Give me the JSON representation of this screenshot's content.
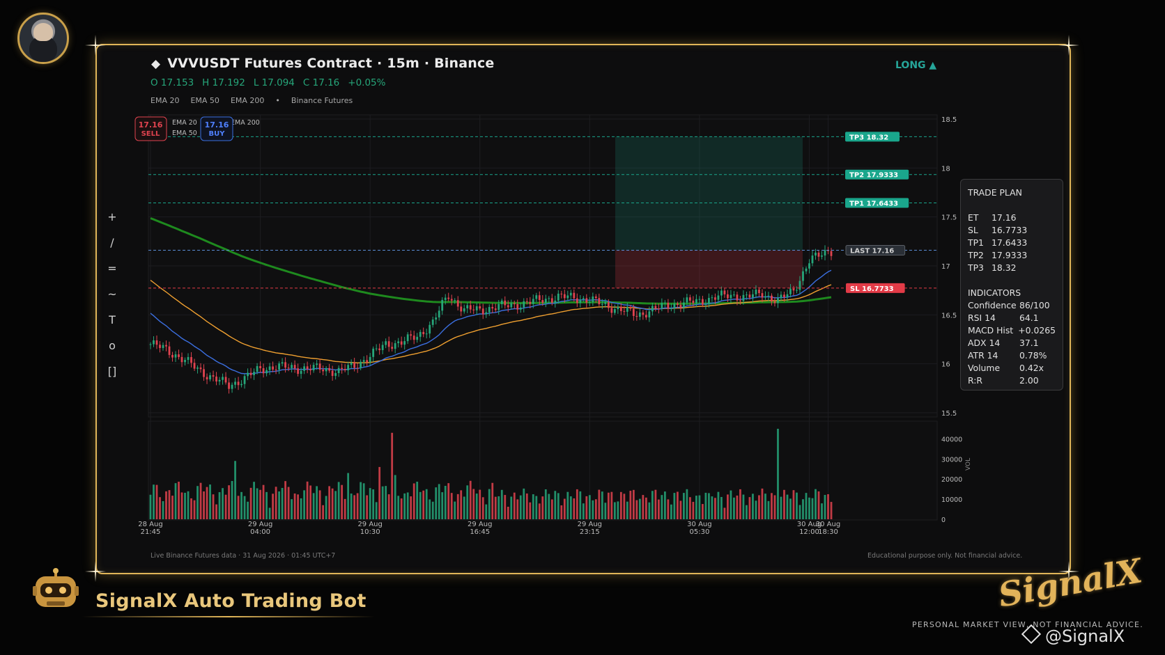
{
  "header": {
    "title": "VVVUSDT Futures Contract · 15m · Binance",
    "open": "O 17.153",
    "high": "H 17.192",
    "low": "L 17.094",
    "close": "C 17.16",
    "change": "+0.05%",
    "indicators": [
      "EMA 20",
      "EMA 50",
      "EMA 200",
      "•",
      "Binance Futures"
    ],
    "direction": "LONG ▲"
  },
  "toolbar": [
    "+",
    "/",
    "=",
    "~",
    "T",
    "o",
    "[]"
  ],
  "chart_badges": {
    "sell_price": "17.16",
    "sell_label": "SELL",
    "buy_price": "17.16",
    "buy_label": "BUY",
    "legend": [
      "EMA 20",
      "EMA 50",
      "EMA 200"
    ]
  },
  "trade_plan": {
    "heading": "TRADE PLAN",
    "levels": [
      {
        "k": "ET",
        "v": "17.16"
      },
      {
        "k": "SL",
        "v": "16.7733"
      },
      {
        "k": "TP1",
        "v": "17.6433"
      },
      {
        "k": "TP2",
        "v": "17.9333"
      },
      {
        "k": "TP3",
        "v": "18.32"
      }
    ],
    "indicators_heading": "INDICATORS",
    "indicators": [
      {
        "k": "Confidence",
        "v": "86/100"
      },
      {
        "k": "RSI 14",
        "v": "64.1"
      },
      {
        "k": "MACD Hist",
        "v": "+0.0265"
      },
      {
        "k": "ADX 14",
        "v": "37.1"
      },
      {
        "k": "ATR 14",
        "v": "0.78%"
      },
      {
        "k": "Volume",
        "v": "0.42x"
      },
      {
        "k": "R:R",
        "v": "2.00"
      }
    ]
  },
  "footer": {
    "left": "Live Binance Futures data  ·  31 Aug 2026 · 01:45 UTC+7",
    "right": "Educational purpose only. Not financial advice."
  },
  "branding": {
    "bot_name": "SignalX Auto Trading Bot",
    "logo_text": "SignalX",
    "disclaimer": "PERSONAL MARKET VIEW, NOT FINANCIAL ADVICE.",
    "handle": "@SignalX"
  },
  "colors": {
    "up": "#26a67a",
    "down": "#e0434f",
    "ema20": "#3b6fe0",
    "ema50": "#f0a030",
    "ema200": "#1e8a1e",
    "tp": "#1aa68c",
    "sl": "#e33b47",
    "gold": "#e1b659"
  },
  "chart_data": {
    "type": "candlestick",
    "symbol": "VVVUSDT",
    "interval": "15m",
    "y_ticks": [
      15.5,
      16,
      16.5,
      17,
      17.5,
      18,
      18.5
    ],
    "ylim": [
      15.5,
      18.5
    ],
    "x_ticks": [
      "28 Aug 21:45",
      "29 Aug 04:00",
      "29 Aug 10:30",
      "29 Aug 16:45",
      "29 Aug 23:15",
      "30 Aug 05:30",
      "30 Aug 12:00",
      "30 Aug 18:30"
    ],
    "levels": [
      {
        "name": "TP3",
        "label": "TP3  18.32",
        "value": 18.32,
        "color": "#1aa68c"
      },
      {
        "name": "TP2",
        "label": "TP2  17.9333",
        "value": 17.9333,
        "color": "#1aa68c"
      },
      {
        "name": "TP1",
        "label": "TP1  17.6433",
        "value": 17.6433,
        "color": "#1aa68c"
      },
      {
        "name": "LAST",
        "label": "LAST  17.16",
        "value": 17.16,
        "color": "#5a8cd6"
      },
      {
        "name": "SL",
        "label": "SL  16.7733",
        "value": 16.7733,
        "color": "#e33b47"
      }
    ],
    "close_anchors": [
      [
        0,
        16.2
      ],
      [
        5,
        16.15
      ],
      [
        10,
        16.05
      ],
      [
        15,
        15.95
      ],
      [
        20,
        15.85
      ],
      [
        25,
        15.78
      ],
      [
        30,
        15.85
      ],
      [
        35,
        15.95
      ],
      [
        40,
        15.97
      ],
      [
        45,
        15.96
      ],
      [
        50,
        15.95
      ],
      [
        55,
        15.95
      ],
      [
        60,
        15.92
      ],
      [
        65,
        15.98
      ],
      [
        70,
        16.08
      ],
      [
        75,
        16.2
      ],
      [
        80,
        16.22
      ],
      [
        85,
        16.28
      ],
      [
        90,
        16.42
      ],
      [
        93,
        16.6
      ],
      [
        95,
        16.7
      ],
      [
        100,
        16.55
      ],
      [
        105,
        16.55
      ],
      [
        110,
        16.58
      ],
      [
        115,
        16.6
      ],
      [
        120,
        16.62
      ],
      [
        125,
        16.66
      ],
      [
        130,
        16.68
      ],
      [
        135,
        16.68
      ],
      [
        140,
        16.65
      ],
      [
        145,
        16.6
      ],
      [
        150,
        16.55
      ],
      [
        155,
        16.5
      ],
      [
        160,
        16.55
      ],
      [
        165,
        16.6
      ],
      [
        170,
        16.62
      ],
      [
        175,
        16.64
      ],
      [
        180,
        16.68
      ],
      [
        185,
        16.7
      ],
      [
        190,
        16.68
      ],
      [
        195,
        16.72
      ],
      [
        200,
        16.64
      ],
      [
        205,
        16.75
      ],
      [
        210,
        17.05
      ],
      [
        213,
        17.1
      ],
      [
        216,
        17.16
      ]
    ],
    "ema200_start": 17.5,
    "ema50_start": 16.88,
    "ema20_start": 16.55,
    "entry_zone": {
      "top": 18.32,
      "entry": 17.16,
      "bottom": 16.7733
    },
    "volume": {
      "y_ticks": [
        0,
        10000,
        20000,
        30000,
        40000
      ],
      "ylim": [
        0,
        45000
      ],
      "ylabel": "VOL",
      "spikes": [
        [
          27,
          29000
        ],
        [
          77,
          43000
        ],
        [
          73,
          26000
        ],
        [
          78,
          22000
        ],
        [
          63,
          23000
        ],
        [
          200,
          45000
        ],
        [
          178,
          13000
        ]
      ]
    }
  }
}
